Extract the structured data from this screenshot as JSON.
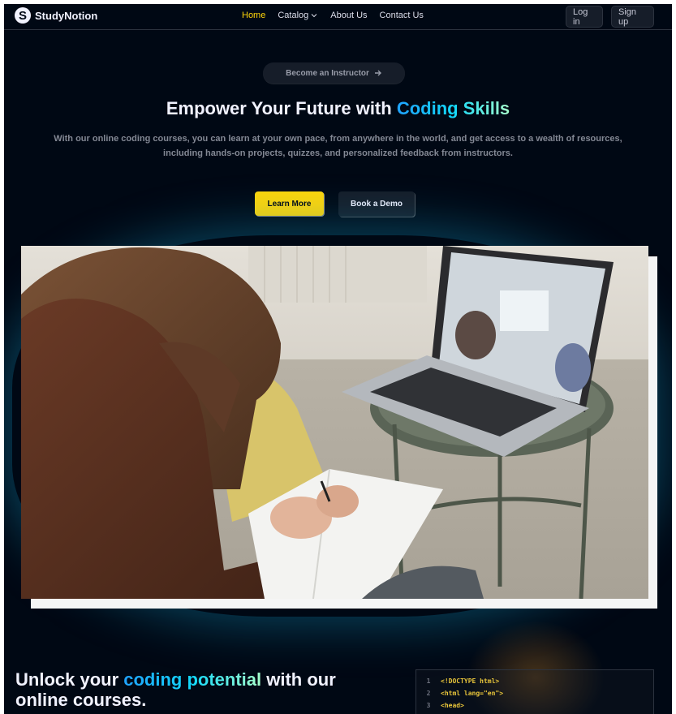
{
  "nav": {
    "logo_letter": "S",
    "logo_text": "StudyNotion",
    "links": [
      {
        "label": "Home",
        "active": true
      },
      {
        "label": "Catalog",
        "dropdown": true
      },
      {
        "label": "About Us"
      },
      {
        "label": "Contact Us"
      }
    ],
    "login_label": "Log in",
    "signup_label": "Sign up"
  },
  "hero": {
    "pill_label": "Become an Instructor",
    "title_prefix": "Empower Your Future with ",
    "title_accent": "Coding Skills",
    "subtitle": "With our online coding courses, you can learn at your own pace, from anywhere in the world, and get access to a wealth of resources, including hands-on projects, quizzes, and personalized feedback from instructors.",
    "primary_button": "Learn More",
    "secondary_button": "Book a Demo"
  },
  "section": {
    "title_prefix": "Unlock your ",
    "title_accent": "coding potential",
    "title_suffix": " with our online courses.",
    "code_lines": [
      {
        "num": "1",
        "text": "<!DOCTYPE html>"
      },
      {
        "num": "2",
        "text": "<html lang=\"en\">"
      },
      {
        "num": "3",
        "text": "<head>"
      }
    ]
  },
  "colors": {
    "background": "#000814",
    "accent_yellow": "#ffd60a",
    "accent_blue": "#12d8fa"
  }
}
